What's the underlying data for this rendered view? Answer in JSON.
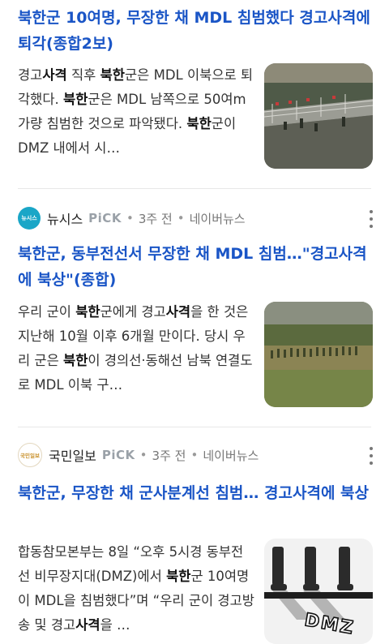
{
  "articles": [
    {
      "title": [
        {
          "t": "북한",
          "b": true
        },
        {
          "t": "군 10여명, 무장한 채 MDL 침범했다 경고",
          "b": false
        },
        {
          "t": "사격",
          "b": true
        },
        {
          "t": "에 퇴각(종합2보)",
          "b": false
        }
      ],
      "snippet": [
        {
          "t": "경고",
          "b": false
        },
        {
          "t": "사격",
          "b": true
        },
        {
          "t": " 직후 ",
          "b": false
        },
        {
          "t": "북한",
          "b": true
        },
        {
          "t": "군은 MDL 이북으로 퇴각했다. ",
          "b": false
        },
        {
          "t": "북한",
          "b": true
        },
        {
          "t": "군은 MDL 남쪽으로 50여m가량 침범한 것으로 파악됐다. ",
          "b": false
        },
        {
          "t": "북한",
          "b": true
        },
        {
          "t": "군이 DMZ 내에서 시…",
          "b": false
        }
      ],
      "thumb_icon": "border-fence-photo"
    },
    {
      "source": {
        "name": "뉴시스",
        "logo_text": "뉴시스",
        "logo_color": "#1aa6c7",
        "pick": "PiCK",
        "time": "3주 전",
        "provider": "네이버뉴스"
      },
      "title": [
        {
          "t": "북한",
          "b": true
        },
        {
          "t": "군, 동부전선서 무장한 채 MDL 침범…\"경고",
          "b": false
        },
        {
          "t": "사격",
          "b": true
        },
        {
          "t": "에 북상\"(종합)",
          "b": false
        }
      ],
      "snippet": [
        {
          "t": "우리 군이 ",
          "b": false
        },
        {
          "t": "북한",
          "b": true
        },
        {
          "t": "군에게 경고",
          "b": false
        },
        {
          "t": "사격",
          "b": true
        },
        {
          "t": "을 한 것은 지난해 10월 이후 6개월 만이다. 당시 우리 군은 ",
          "b": false
        },
        {
          "t": "북한",
          "b": true
        },
        {
          "t": "이 경의선·동해선 남북 연결도로 MDL 이북 구…",
          "b": false
        }
      ],
      "thumb_icon": "soldiers-field-photo"
    },
    {
      "source": {
        "name": "국민일보",
        "logo_text": "국민일보",
        "logo_color": "#c8902a",
        "pick": "PiCK",
        "time": "3주 전",
        "provider": "네이버뉴스"
      },
      "title": [
        {
          "t": "북한",
          "b": true
        },
        {
          "t": "군, 무장한 채 군사분계선 침범… 경고",
          "b": false
        },
        {
          "t": "사격",
          "b": true
        },
        {
          "t": "에 북상",
          "b": false
        }
      ],
      "snippet": [
        {
          "t": "합동참모본부는 8일 “오후 5시경 동부전선 비무장지대(DMZ)에서 ",
          "b": false
        },
        {
          "t": "북한",
          "b": true
        },
        {
          "t": "군 10여명이 MDL을 침범했다”며 “우리 군이 경고방송 및 경고",
          "b": false
        },
        {
          "t": "사격",
          "b": true
        },
        {
          "t": "을 …",
          "b": false
        }
      ],
      "thumb_icon": "dmz-illustration",
      "thumb_text": "DMZ"
    }
  ]
}
